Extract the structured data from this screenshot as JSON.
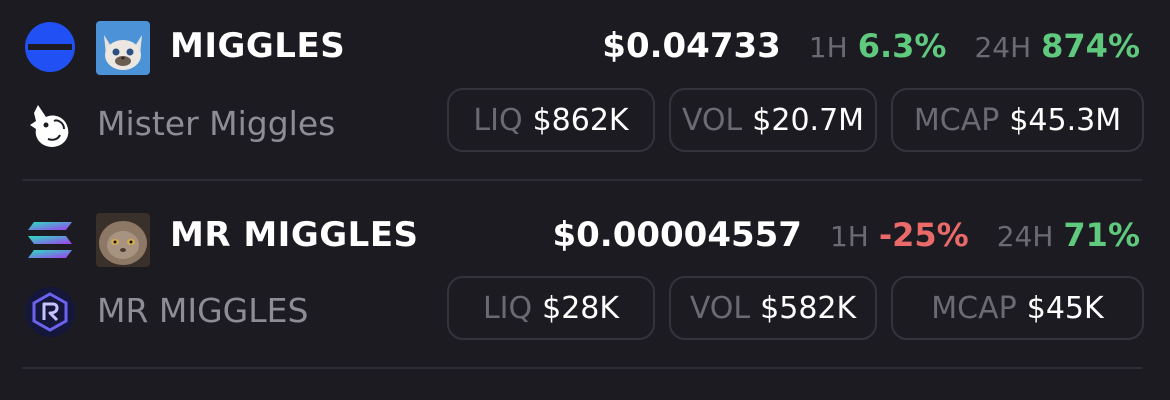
{
  "tokens": [
    {
      "chain_icon": "base-chain-icon",
      "token_image": "cat-avatar-white",
      "symbol": "MIGGLES",
      "dex_icon": "uniswap-unicorn-icon",
      "name": "Mister Miggles",
      "price": "$0.04733",
      "change_1h_label": "1H",
      "change_1h": "6.3%",
      "change_1h_color": "#5fc97e",
      "change_24h_label": "24H",
      "change_24h": "874%",
      "change_24h_color": "#5fc97e",
      "liq_label": "LIQ",
      "liq": "$862K",
      "vol_label": "VOL",
      "vol": "$20.7M",
      "mcap_label": "MCAP",
      "mcap": "$45.3M"
    },
    {
      "chain_icon": "solana-chain-icon",
      "token_image": "cat-avatar-persian",
      "symbol": "MR MIGGLES",
      "dex_icon": "raydium-icon",
      "name": "MR MIGGLES",
      "price": "$0.00004557",
      "change_1h_label": "1H",
      "change_1h": "-25%",
      "change_1h_color": "#ea6a6a",
      "change_24h_label": "24H",
      "change_24h": "71%",
      "change_24h_color": "#5fc97e",
      "liq_label": "LIQ",
      "liq": "$28K",
      "vol_label": "VOL",
      "vol": "$582K",
      "mcap_label": "MCAP",
      "mcap": "$45K"
    }
  ],
  "colors": {
    "background": "#1c1b22",
    "muted": "#6b6a73",
    "positive": "#5fc97e",
    "negative": "#ea6a6a",
    "base_blue": "#2151f5"
  }
}
